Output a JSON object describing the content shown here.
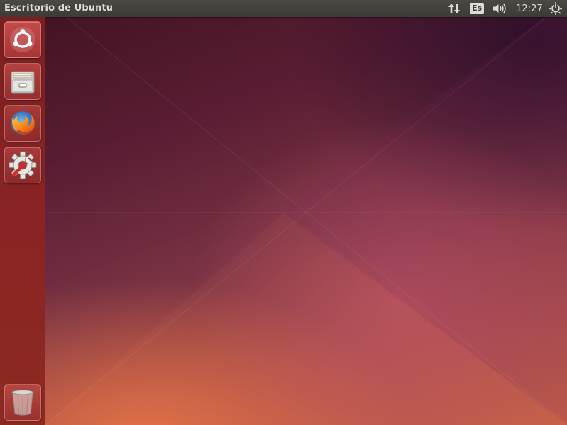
{
  "panel": {
    "title": "Escritorio de Ubuntu",
    "indicators": {
      "network_icon": "network-updown-icon",
      "keyboard_layout": "Es",
      "sound_icon": "volume-icon",
      "clock": "12:27",
      "session_icon": "power-gear-icon"
    }
  },
  "launcher": {
    "items": [
      {
        "id": "dash",
        "icon": "ubuntu-logo-icon"
      },
      {
        "id": "files",
        "icon": "file-cabinet-icon"
      },
      {
        "id": "firefox",
        "icon": "firefox-icon"
      },
      {
        "id": "settings",
        "icon": "system-settings-icon"
      }
    ],
    "trash": {
      "icon": "trash-icon"
    }
  },
  "colors": {
    "panel_bg": "#3c3b37",
    "panel_text": "#dfdbd2",
    "launcher_bg": "#8a2424",
    "wallpaper_dark": "#3e1220",
    "wallpaper_warm": "#c46048"
  }
}
